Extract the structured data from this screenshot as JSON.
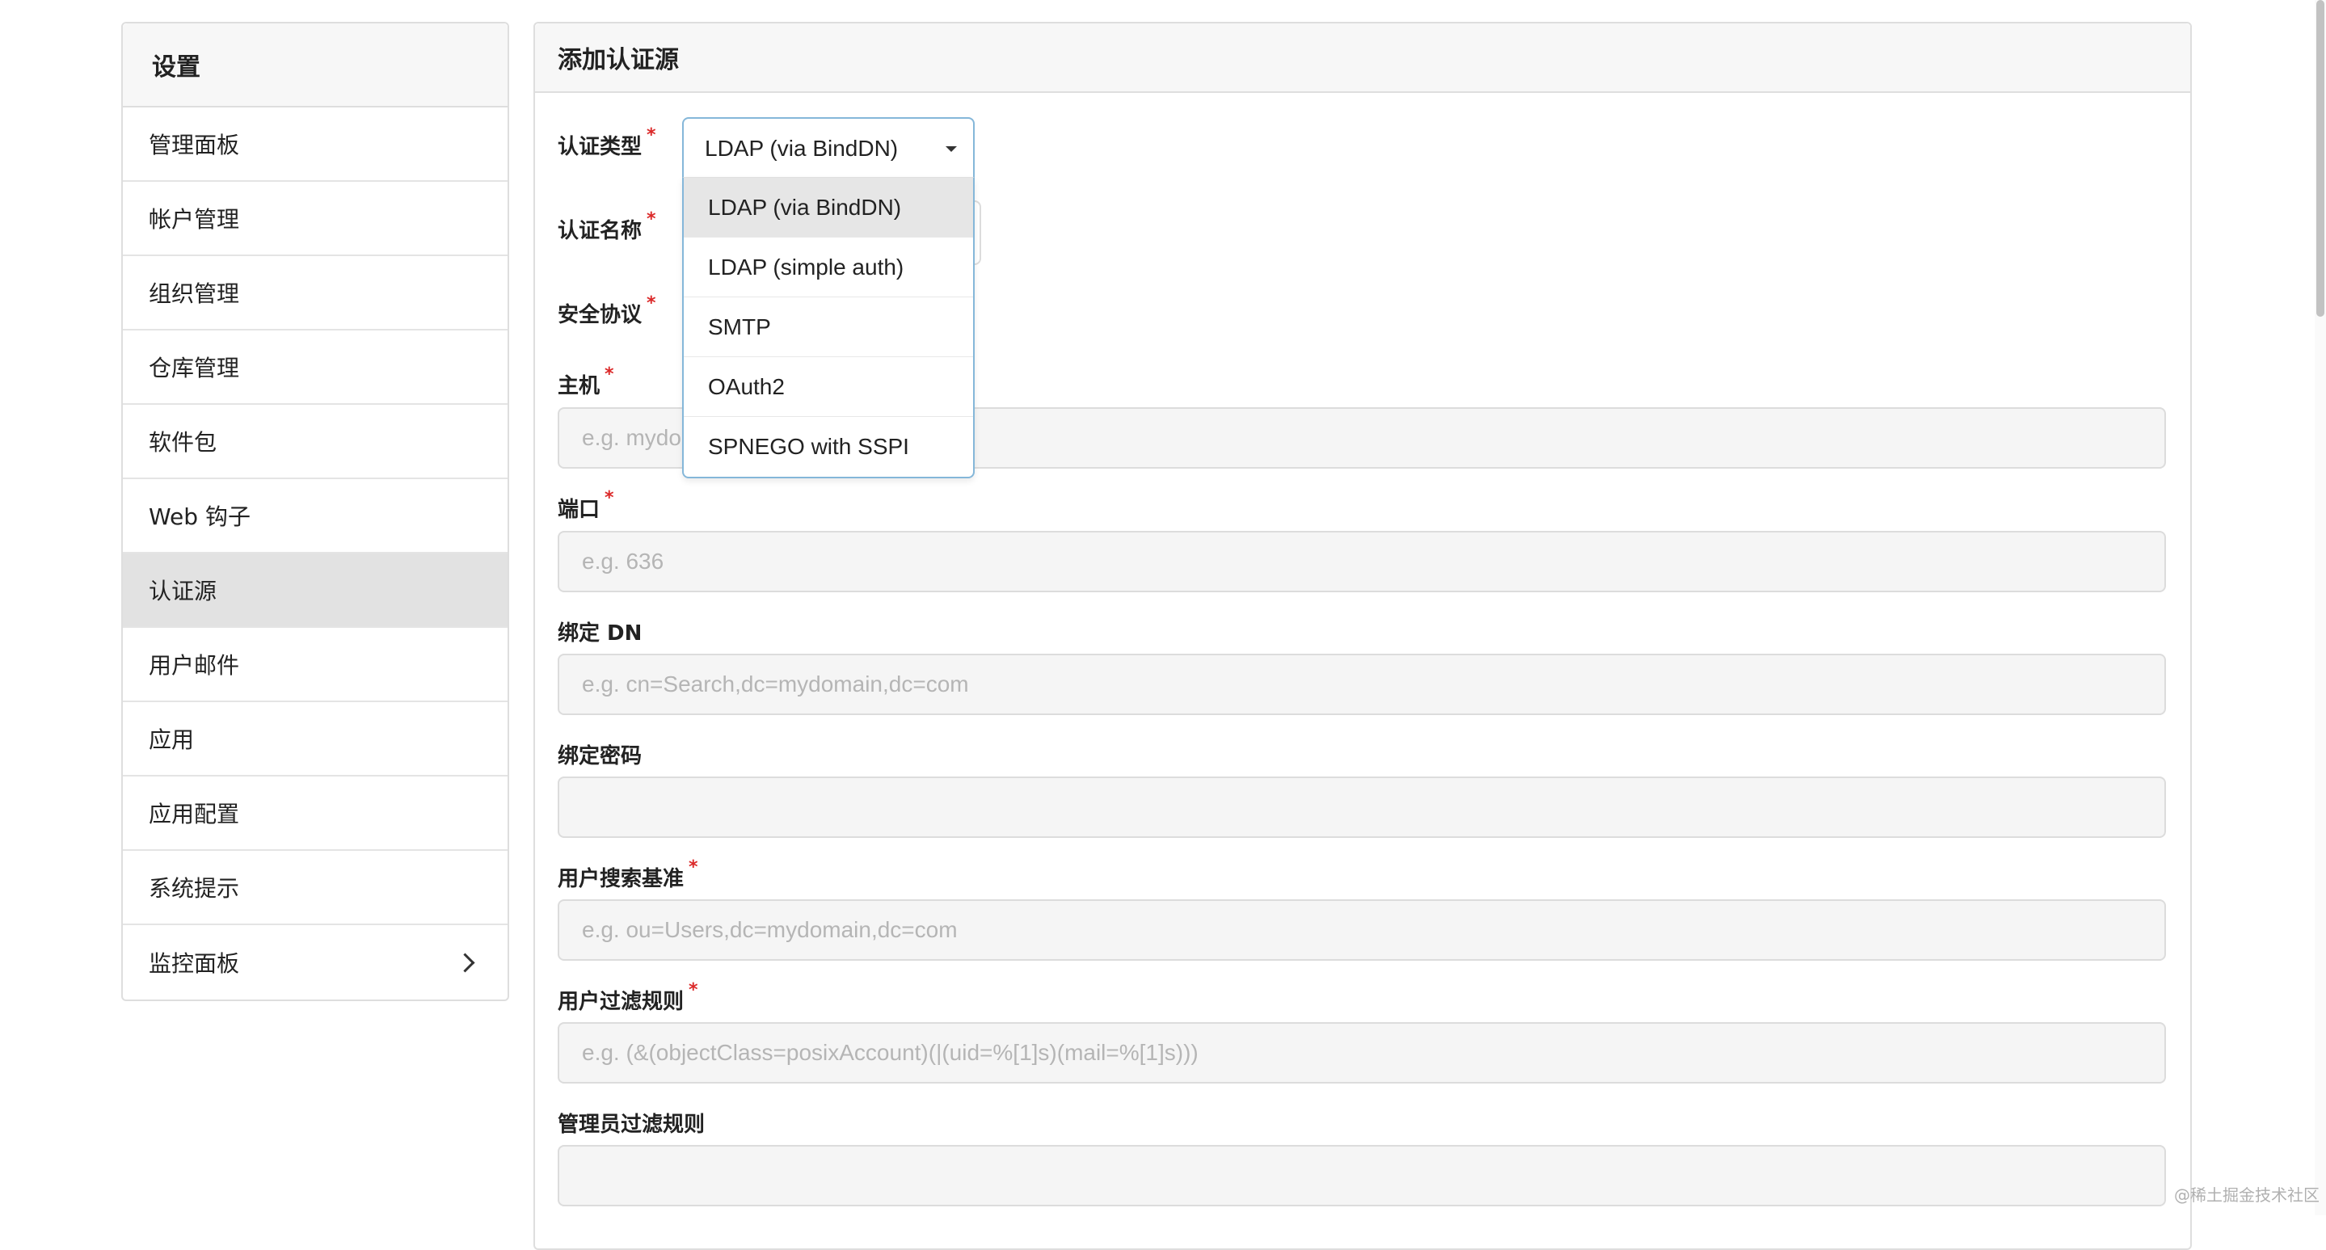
{
  "sidebar": {
    "title": "设置",
    "items": [
      {
        "label": "管理面板"
      },
      {
        "label": "帐户管理"
      },
      {
        "label": "组织管理"
      },
      {
        "label": "仓库管理"
      },
      {
        "label": "软件包"
      },
      {
        "label": "Web 钩子"
      },
      {
        "label": "认证源",
        "active": true
      },
      {
        "label": "用户邮件"
      },
      {
        "label": "应用"
      },
      {
        "label": "应用配置"
      },
      {
        "label": "系统提示"
      },
      {
        "label": "监控面板",
        "has_submenu": true
      }
    ]
  },
  "form": {
    "title": "添加认证源",
    "required_mark": "*",
    "auth_type": {
      "label": "认证类型",
      "value": "LDAP (via BindDN)",
      "options": [
        "LDAP (via BindDN)",
        "LDAP (simple auth)",
        "SMTP",
        "OAuth2",
        "SPNEGO with SSPI"
      ]
    },
    "auth_name": {
      "label": "认证名称"
    },
    "security_protocol": {
      "label": "安全协议"
    },
    "host": {
      "label": "主机",
      "placeholder": "e.g. mydomain.com"
    },
    "port": {
      "label": "端口",
      "placeholder": "e.g. 636"
    },
    "bind_dn": {
      "label": "绑定 DN",
      "placeholder": "e.g. cn=Search,dc=mydomain,dc=com"
    },
    "bind_password": {
      "label": "绑定密码",
      "placeholder": ""
    },
    "user_search_base": {
      "label": "用户搜索基准",
      "placeholder": "e.g. ou=Users,dc=mydomain,dc=com"
    },
    "user_filter": {
      "label": "用户过滤规则",
      "placeholder": "e.g. (&(objectClass=posixAccount)(|(uid=%[1]s)(mail=%[1]s)))"
    },
    "admin_filter": {
      "label": "管理员过滤规则",
      "placeholder": ""
    }
  },
  "watermark": "@稀土掘金技术社区"
}
